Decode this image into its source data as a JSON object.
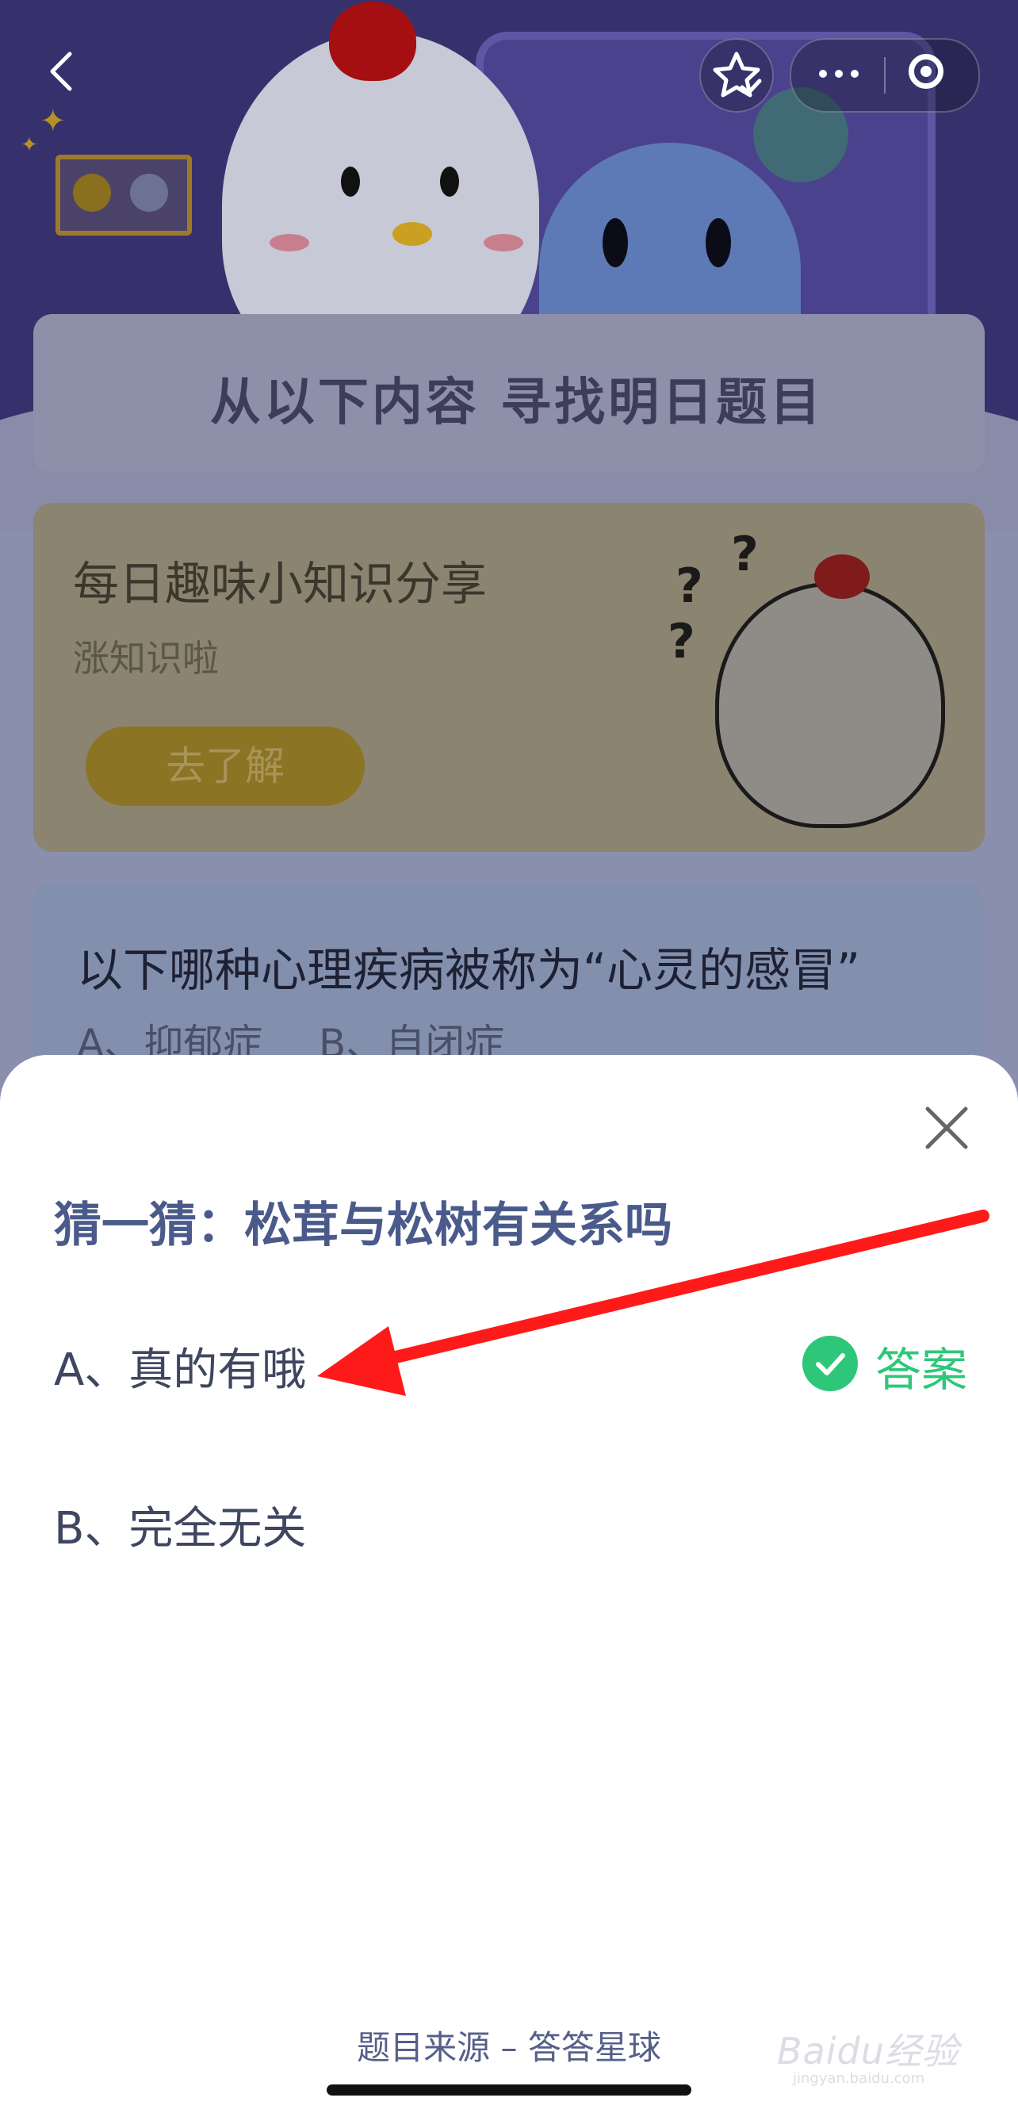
{
  "header": {
    "back_icon": "chevron-left-icon",
    "favorite_icon": "star-check-icon",
    "more_icon": "ellipsis-icon",
    "close_miniapp_icon": "target-circle-icon"
  },
  "banner": {
    "title": "从以下内容  寻找明日题目"
  },
  "share_card": {
    "title": "每日趣味小知识分享",
    "subtitle": "涨知识啦",
    "button_label": "去了解"
  },
  "question_card": {
    "question": "以下哪种心理疾病被称为“心灵的感冒”",
    "option_a": "A、抑郁症",
    "option_b": "B、自闭症"
  },
  "sheet": {
    "close_icon": "close-icon",
    "title": "猜一猜：松茸与松树有关系吗",
    "options": [
      {
        "text": "A、真的有哦",
        "is_answer": true
      },
      {
        "text": "B、完全无关",
        "is_answer": false
      }
    ],
    "answer_label": "答案",
    "answer_color": "#2ec77a",
    "footer": "题目来源 – 答答星球"
  },
  "annotation": {
    "arrow_color": "#ff1a1a"
  },
  "watermark": {
    "brand": "Baidu经验",
    "domain": "jingyan.baidu.com"
  }
}
